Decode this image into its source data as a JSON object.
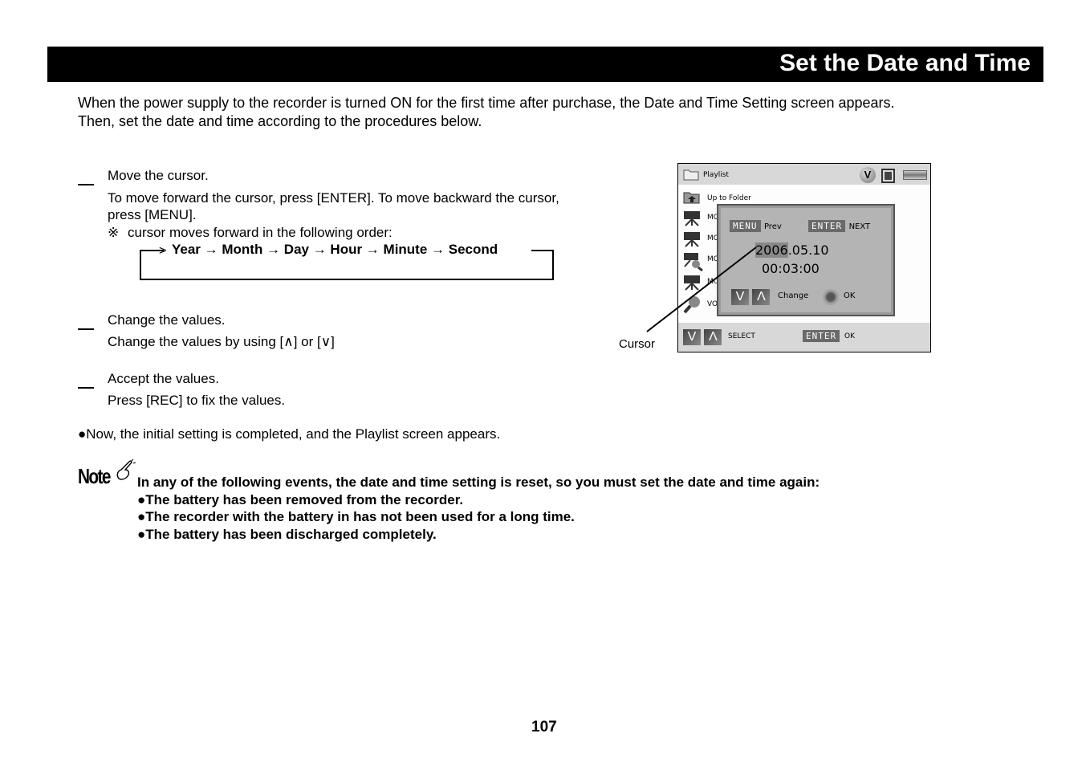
{
  "header": {
    "title": "Set the Date and Time"
  },
  "intro": [
    "When the power supply to the recorder is turned ON for the first time after purchase, the Date and Time Setting screen appears.",
    "Then, set the date and time according to the procedures below."
  ],
  "steps": [
    {
      "heading": "Move the cursor.",
      "body": [
        "To move forward the cursor, press [ENTER]. To move backward the cursor,",
        "press [MENU]."
      ],
      "note_symbol": "※",
      "note": "cursor moves forward in the following order:",
      "order": "Year → Month → Day → Hour → Minute → Second"
    },
    {
      "heading": "Change the values.",
      "body": [
        "Change the values by using [∧] or [∨]"
      ]
    },
    {
      "heading": "Accept the values.",
      "body": [
        "Press [REC] to fix the values."
      ]
    }
  ],
  "completion": "●Now, the initial setting is completed, and the Playlist screen appears.",
  "figure": {
    "callout_label": "Cursor",
    "screen": {
      "header_title": "Playlist",
      "header_badge": "V",
      "list_items": [
        {
          "icon": "up-folder-icon",
          "label": "Up to Folder"
        },
        {
          "icon": "movie-camera-icon",
          "label": "MO"
        },
        {
          "icon": "movie-camera-icon",
          "label": "MO"
        },
        {
          "icon": "camera-search-icon",
          "label": "MO"
        },
        {
          "icon": "movie-camera-icon",
          "label": "MO"
        },
        {
          "icon": "voice-icon",
          "label": "VO"
        }
      ],
      "popup": {
        "menu_key": "MENU",
        "menu_action": "Prev",
        "enter_key": "ENTER",
        "enter_action": "NEXT",
        "date_selected": "2006",
        "date_rest": ".05.10",
        "time": "00:03:00",
        "down_glyph": "V",
        "up_glyph": "Λ",
        "change_label": "Change",
        "ok_label": "OK"
      },
      "footer": {
        "down_glyph": "V",
        "up_glyph": "Λ",
        "select_label": "SELECT",
        "enter_key": "ENTER",
        "ok_label": "OK"
      }
    }
  },
  "note": {
    "logo": "Note",
    "intro": "In any of the following events, the date and time setting is reset, so you must set the date and time again:",
    "items": [
      "●The battery has been removed from the recorder.",
      "●The recorder with the battery in has not been used for a long time.",
      "●The battery has been discharged completely."
    ]
  },
  "page_number": "107"
}
